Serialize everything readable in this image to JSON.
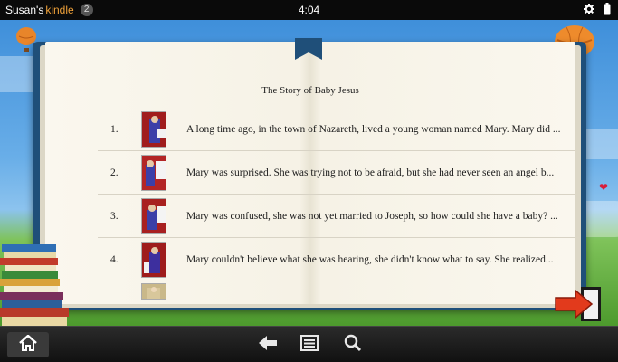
{
  "status_bar": {
    "owner": "Susan's",
    "product": "kindle",
    "notification_count": "2",
    "time": "4:04",
    "icons": [
      "gear-icon",
      "battery-icon"
    ]
  },
  "book": {
    "title": "The Story of Baby Jesus",
    "chapters": [
      {
        "number": "1.",
        "text": "A long time ago, in the town of Nazareth, lived a young woman named Mary.  Mary did ..."
      },
      {
        "number": "2.",
        "text": "Mary was surprised. She was trying not to be afraid, but she had never seen an angel b..."
      },
      {
        "number": "3.",
        "text": "Mary was confused, she was not yet married to Joseph, so how could she have a baby?  ..."
      },
      {
        "number": "4.",
        "text": "Mary couldn't believe what she was hearing, she didn't know what to say.  She realized..."
      }
    ]
  },
  "nav_bar": {
    "icons": [
      "home-icon",
      "back-arrow-icon",
      "menu-icon",
      "search-icon"
    ]
  },
  "colors": {
    "brand_orange": "#f0a23a",
    "book_cover": "#1f4f79",
    "next_arrow": "#e23a1c"
  }
}
